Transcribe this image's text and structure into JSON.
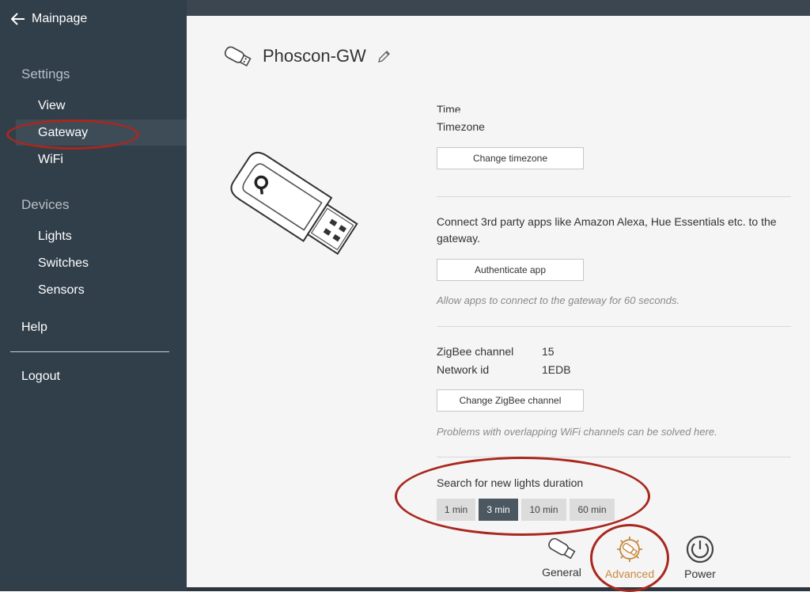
{
  "sidebar": {
    "back_label": "Mainpage",
    "settings_heading": "Settings",
    "settings_items": [
      {
        "label": "View"
      },
      {
        "label": "Gateway"
      },
      {
        "label": "WiFi"
      }
    ],
    "devices_heading": "Devices",
    "devices_items": [
      {
        "label": "Lights"
      },
      {
        "label": "Switches"
      },
      {
        "label": "Sensors"
      }
    ],
    "help_label": "Help",
    "logout_label": "Logout",
    "active_item": "Gateway"
  },
  "header": {
    "title": "Phoscon-GW",
    "edit_icon": "pencil-icon",
    "device_icon": "usb-stick-icon"
  },
  "time": {
    "cut_label": "Time",
    "timezone_label": "Timezone",
    "change_button": "Change timezone"
  },
  "auth": {
    "text": "Connect 3rd party apps like Amazon Alexa, Hue Essentials etc. to the gateway.",
    "button": "Authenticate app",
    "note": "Allow apps to connect to the gateway for 60 seconds."
  },
  "zigbee": {
    "channel_label": "ZigBee channel",
    "channel_value": "15",
    "network_label": "Network id",
    "network_value": "1EDB",
    "button": "Change ZigBee channel",
    "note": "Problems with overlapping WiFi channels can be solved here."
  },
  "search": {
    "label": "Search for new lights duration",
    "options": [
      "1 min",
      "3 min",
      "10 min",
      "60 min"
    ],
    "selected": "3 min"
  },
  "tabs": [
    {
      "label": "General",
      "icon": "usb-stick-icon"
    },
    {
      "label": "Advanced",
      "icon": "gear-usb-icon",
      "active": true
    },
    {
      "label": "Power",
      "icon": "power-icon"
    }
  ],
  "colors": {
    "sidebar_bg": "#313f4a",
    "active_tab": "#c8893f",
    "selected_segment": "#4b5761",
    "annotation_red": "#a8281f"
  }
}
